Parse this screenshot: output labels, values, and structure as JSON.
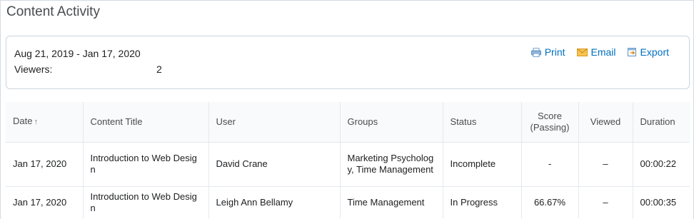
{
  "page": {
    "title": "Content Activity"
  },
  "summary": {
    "range": "Aug 21, 2019 - Jan 17, 2020",
    "viewers_label": "Viewers:",
    "viewers_value": "2"
  },
  "actions": {
    "print": "Print",
    "email": "Email",
    "export": "Export"
  },
  "table": {
    "headers": {
      "date": "Date",
      "sort_arrow": "↑",
      "content_title": "Content Title",
      "user": "User",
      "groups": "Groups",
      "status": "Status",
      "score": "Score (Passing)",
      "viewed": "Viewed",
      "duration": "Duration"
    },
    "rows": [
      {
        "date": "Jan 17, 2020",
        "content_title": "Introduction to Web Design",
        "user": "David Crane",
        "groups": "Marketing Psychology, Time Management",
        "status": "Incomplete",
        "score": "-",
        "viewed": "–",
        "duration": "00:00:22"
      },
      {
        "date": "Jan 17, 2020",
        "content_title": "Introduction to Web Design",
        "user": "Leigh Ann Bellamy",
        "groups": "Time Management",
        "status": "In Progress",
        "score": "66.67%",
        "viewed": "–",
        "duration": "00:00:35"
      }
    ]
  },
  "colors": {
    "link": "#006fbf",
    "incomplete": "#a0361e",
    "border": "#cdd5dc"
  }
}
